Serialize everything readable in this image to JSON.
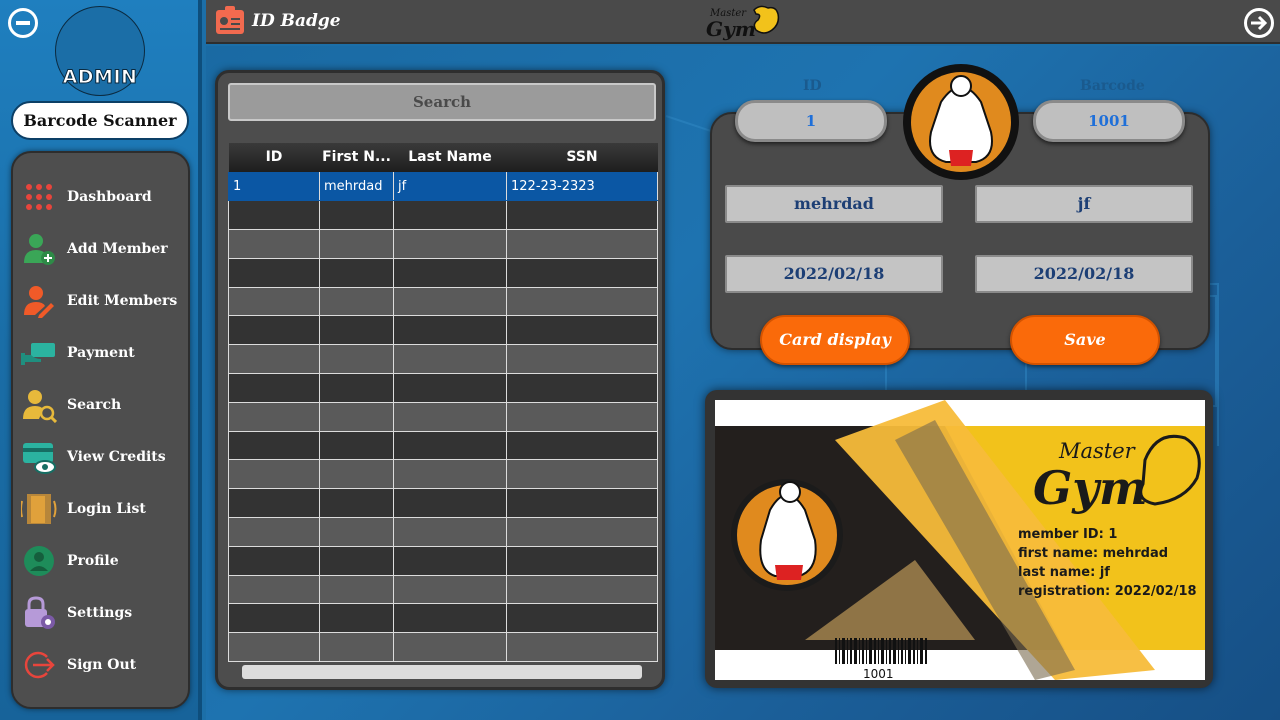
{
  "sidebar": {
    "role_label": "ADMIN",
    "barcode_button": "Barcode Scanner",
    "items": [
      {
        "label": "Dashboard"
      },
      {
        "label": "Add Member"
      },
      {
        "label": "Edit Members"
      },
      {
        "label": "Payment"
      },
      {
        "label": "Search"
      },
      {
        "label": "View Credits"
      },
      {
        "label": "Login List"
      },
      {
        "label": "Profile"
      },
      {
        "label": "Settings"
      },
      {
        "label": "Sign Out"
      }
    ]
  },
  "header": {
    "title": "ID Badge",
    "logo_top": "Master",
    "logo_main": "Gym"
  },
  "search": {
    "placeholder": "Search"
  },
  "table": {
    "columns": [
      "ID",
      "First N...",
      "Last Name",
      "SSN"
    ],
    "rows": [
      [
        "1",
        "mehrdad",
        "jf",
        "122-23-2323"
      ]
    ]
  },
  "form": {
    "id_label": "ID",
    "barcode_label": "Barcode",
    "id_value": "1",
    "barcode_value": "1001",
    "first_name": "mehrdad",
    "last_name": "jf",
    "registration_date": "2022/02/18",
    "expiry_date": "2022/02/18",
    "card_display_button": "Card display",
    "save_button": "Save"
  },
  "card": {
    "brand_top": "Master",
    "brand_main": "Gym",
    "member_id_line": "member ID: 1",
    "first_name_line": "first name: mehrdad",
    "last_name_line": "last name: jf",
    "registration_line": "registration: 2022/02/18",
    "barcode_number": "1001"
  },
  "colors": {
    "accent_orange": "#fa6a0a",
    "sidebar_blue": "#1f7fbf",
    "panel_gray": "#4a4a4a",
    "selection_blue": "#0b57a4",
    "card_yellow": "#f2c21b"
  }
}
